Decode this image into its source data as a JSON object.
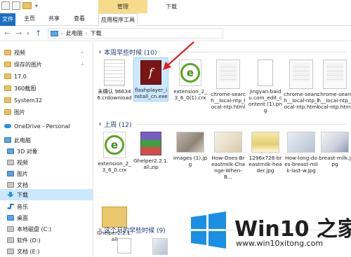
{
  "ribbon": {
    "context_tab": "管理",
    "window_title": "下载",
    "tabs": [
      "文件",
      "主页",
      "共享",
      "查看",
      "应用程序工具"
    ]
  },
  "address": {
    "crumbs": [
      "此电脑",
      "下载"
    ]
  },
  "sidebar": {
    "items": [
      {
        "label": "视频",
        "icon": "folder-video-icon",
        "pinned": true
      },
      {
        "label": "保存的图片",
        "icon": "folder-pictures-icon",
        "pinned": true
      },
      {
        "label": "17.0",
        "icon": "folder-icon"
      },
      {
        "label": "360截图",
        "icon": "folder-icon"
      },
      {
        "label": "System32",
        "icon": "folder-icon"
      },
      {
        "label": "图片",
        "icon": "folder-icon"
      },
      {
        "label": "OneDrive - Personal",
        "icon": "onedrive-icon"
      },
      {
        "label": "此电脑",
        "icon": "this-pc-icon"
      },
      {
        "label": "3D 对象",
        "icon": "3d-objects-icon"
      },
      {
        "label": "视频",
        "icon": "videos-icon"
      },
      {
        "label": "图片",
        "icon": "pictures-icon"
      },
      {
        "label": "文档",
        "icon": "documents-icon"
      },
      {
        "label": "下载",
        "icon": "downloads-icon",
        "selected": true
      },
      {
        "label": "音乐",
        "icon": "music-icon"
      },
      {
        "label": "桌面",
        "icon": "desktop-icon"
      },
      {
        "label": "本地磁盘 (C:)",
        "icon": "drive-icon"
      },
      {
        "label": "软件 (D:)",
        "icon": "drive-icon"
      },
      {
        "label": "文档 (E:)",
        "icon": "drive-icon"
      }
    ]
  },
  "groups": [
    {
      "label": "本周早些时候 (10)"
    },
    {
      "label": "上周 (12)"
    },
    {
      "label": "这个月的早些时候 (9)"
    }
  ],
  "files_week": [
    {
      "name": "未确认 966346.crdownload",
      "icon": "document-icon"
    },
    {
      "name": "flashplayer_install_cn.exe",
      "icon": "flash-installer-icon",
      "selected": true
    },
    {
      "name": "extension_2_3_6_0(1).crx",
      "icon": "ie-document-icon"
    },
    {
      "name": "chrome-search__local-ntp_local-ntp.html",
      "icon": "chrome-html-icon"
    },
    {
      "name": "jingyan.baidu.com_edit_content (1).png",
      "icon": "png-document-icon"
    },
    {
      "name": "chrome-search__local-ntp_local-ntp.html",
      "icon": "chrome-html-icon"
    },
    {
      "name": "chrome-search__local-ntp_local-ntp.html",
      "icon": "chrome-html-icon"
    }
  ],
  "files_lastweek": [
    {
      "name": "extension_2_3_6_0.crx",
      "icon": "ie-document-icon"
    },
    {
      "name": "Ghelper2.2.1.all.zip",
      "icon": "winrar-archive-icon"
    },
    {
      "name": "images (1).jpg",
      "icon": "photo-thumbnail"
    },
    {
      "name": "How-Does-Breastmilk-Change-When-B...",
      "icon": "photo-thumbnail"
    },
    {
      "name": "1296x728-breastmilk-header.jpg",
      "icon": "photo-thumbnail"
    },
    {
      "name": "How-long-does-breast-milk-last-w.jpg",
      "icon": "photo-thumbnail"
    },
    {
      "name": "breast-milk.jpg",
      "icon": "photo-thumbnail"
    },
    {
      "name": "Ghelper2.2.1.all",
      "icon": "folder-icon"
    }
  ],
  "watermark": {
    "title": "Win10 之家",
    "url": "www.win10xitong.com"
  }
}
